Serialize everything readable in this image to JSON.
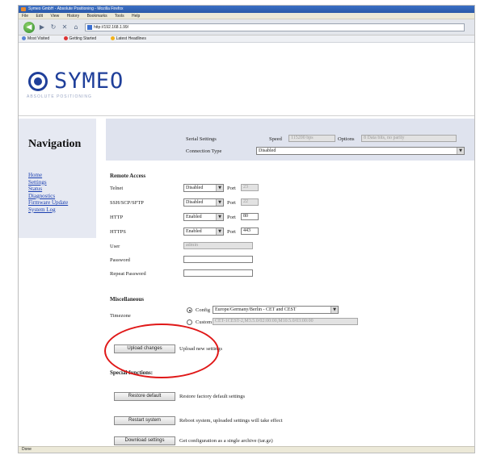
{
  "browser": {
    "title": "Symeo GmbH - Absolute Positioning - Mozilla Firefox",
    "menu": [
      "File",
      "Edit",
      "View",
      "History",
      "Bookmarks",
      "Tools",
      "Help"
    ],
    "url": "http://192.168.1.99/",
    "bookmarks": [
      "Most Visited",
      "Getting Started",
      "Latest Headlines"
    ],
    "status": "Done"
  },
  "logo": {
    "name": "SYMEO",
    "tagline": "ABSOLUTE POSITIONING"
  },
  "nav": {
    "title": "Navigation",
    "links": [
      "Home",
      "Settings",
      "Status",
      "Diagnostics",
      "Firmware Update",
      "System Log"
    ]
  },
  "serial": {
    "settings_label": "Serial Settings",
    "speed_label": "Speed",
    "speed_value": "115200 bps",
    "options_label": "Options",
    "options_value": "8 Data bits, no parity",
    "connection_label": "Connection Type",
    "connection_value": "Disabled"
  },
  "remote_access": {
    "heading": "Remote Access",
    "port_label": "Port",
    "rows": [
      {
        "label": "Telnet",
        "value": "Disabled",
        "port": "23"
      },
      {
        "label": "SSH/SCP/SFTP",
        "value": "Disabled",
        "port": "22"
      },
      {
        "label": "HTTP",
        "value": "Enabled",
        "port": "80"
      },
      {
        "label": "HTTPS",
        "value": "Enabled",
        "port": "443"
      }
    ],
    "user_label": "User",
    "user_value": "admin",
    "password_label": "Password",
    "repeat_password_label": "Repeat Password"
  },
  "misc": {
    "heading": "Miscellaneous",
    "timezone_label": "Timezone",
    "config_label": "Config",
    "config_value": "Europe/Germany/Berlin - CET and CEST",
    "custom_label": "Custom",
    "custom_value": "CET-1CEST-2,M3.5.0/02:00:00,M10.5.0/03:00:00"
  },
  "actions": {
    "upload_button": "Upload changes",
    "upload_desc": "Upload new settings",
    "special_heading": "Special functions:",
    "restore_button": "Restore default",
    "restore_desc": "Restore factory default settings",
    "reboot_button": "Restart system",
    "reboot_desc": "Reboot system, uploaded settings will take effect",
    "download_button": "Download settings",
    "download_desc": "Get configuration as a single archive (tar.gz)"
  },
  "colors": {
    "brand": "#1f3f9a",
    "callout": "#e01818",
    "panel": "#dfe3ee"
  }
}
